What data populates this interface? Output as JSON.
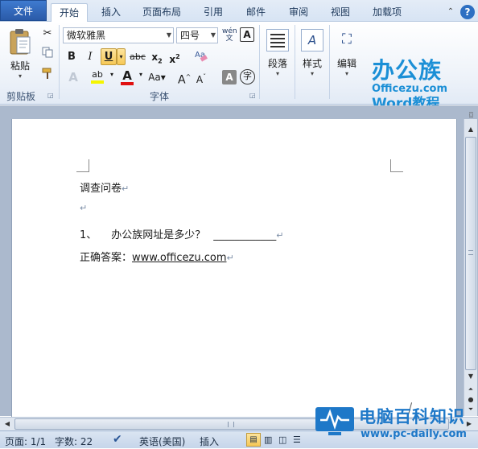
{
  "tabs": [
    "文件",
    "开始",
    "插入",
    "页面布局",
    "引用",
    "邮件",
    "审阅",
    "视图",
    "加载项"
  ],
  "clipboard": {
    "paste_label": "粘贴",
    "group_label": "剪贴板"
  },
  "font": {
    "name": "微软雅黑",
    "size": "四号",
    "group_label": "字体"
  },
  "paragraph": {
    "label": "段落"
  },
  "styles": {
    "label": "样式"
  },
  "editing": {
    "label": "编辑"
  },
  "watermark_top": {
    "title": "办公族",
    "site": "Officezu.com",
    "subtitle": "Word教程"
  },
  "document": {
    "line1": "调查问卷",
    "question_number": "1、",
    "question_text": "办公族网址是多少？",
    "blank": "____________",
    "answer_label": "正确答案：",
    "answer_url": "www.officezu.com"
  },
  "status": {
    "page": "页面: 1/1",
    "words": "字数: 22",
    "language": "英语(美国)",
    "mode": "插入"
  },
  "watermark_bottom": {
    "title": "电脑百科知识",
    "site": "www.pc-daily.com"
  },
  "colors": {
    "accent": "#2a5aa8",
    "watermark_blue": "#1b8fd6",
    "pc_daily_blue": "#1e78c8"
  }
}
